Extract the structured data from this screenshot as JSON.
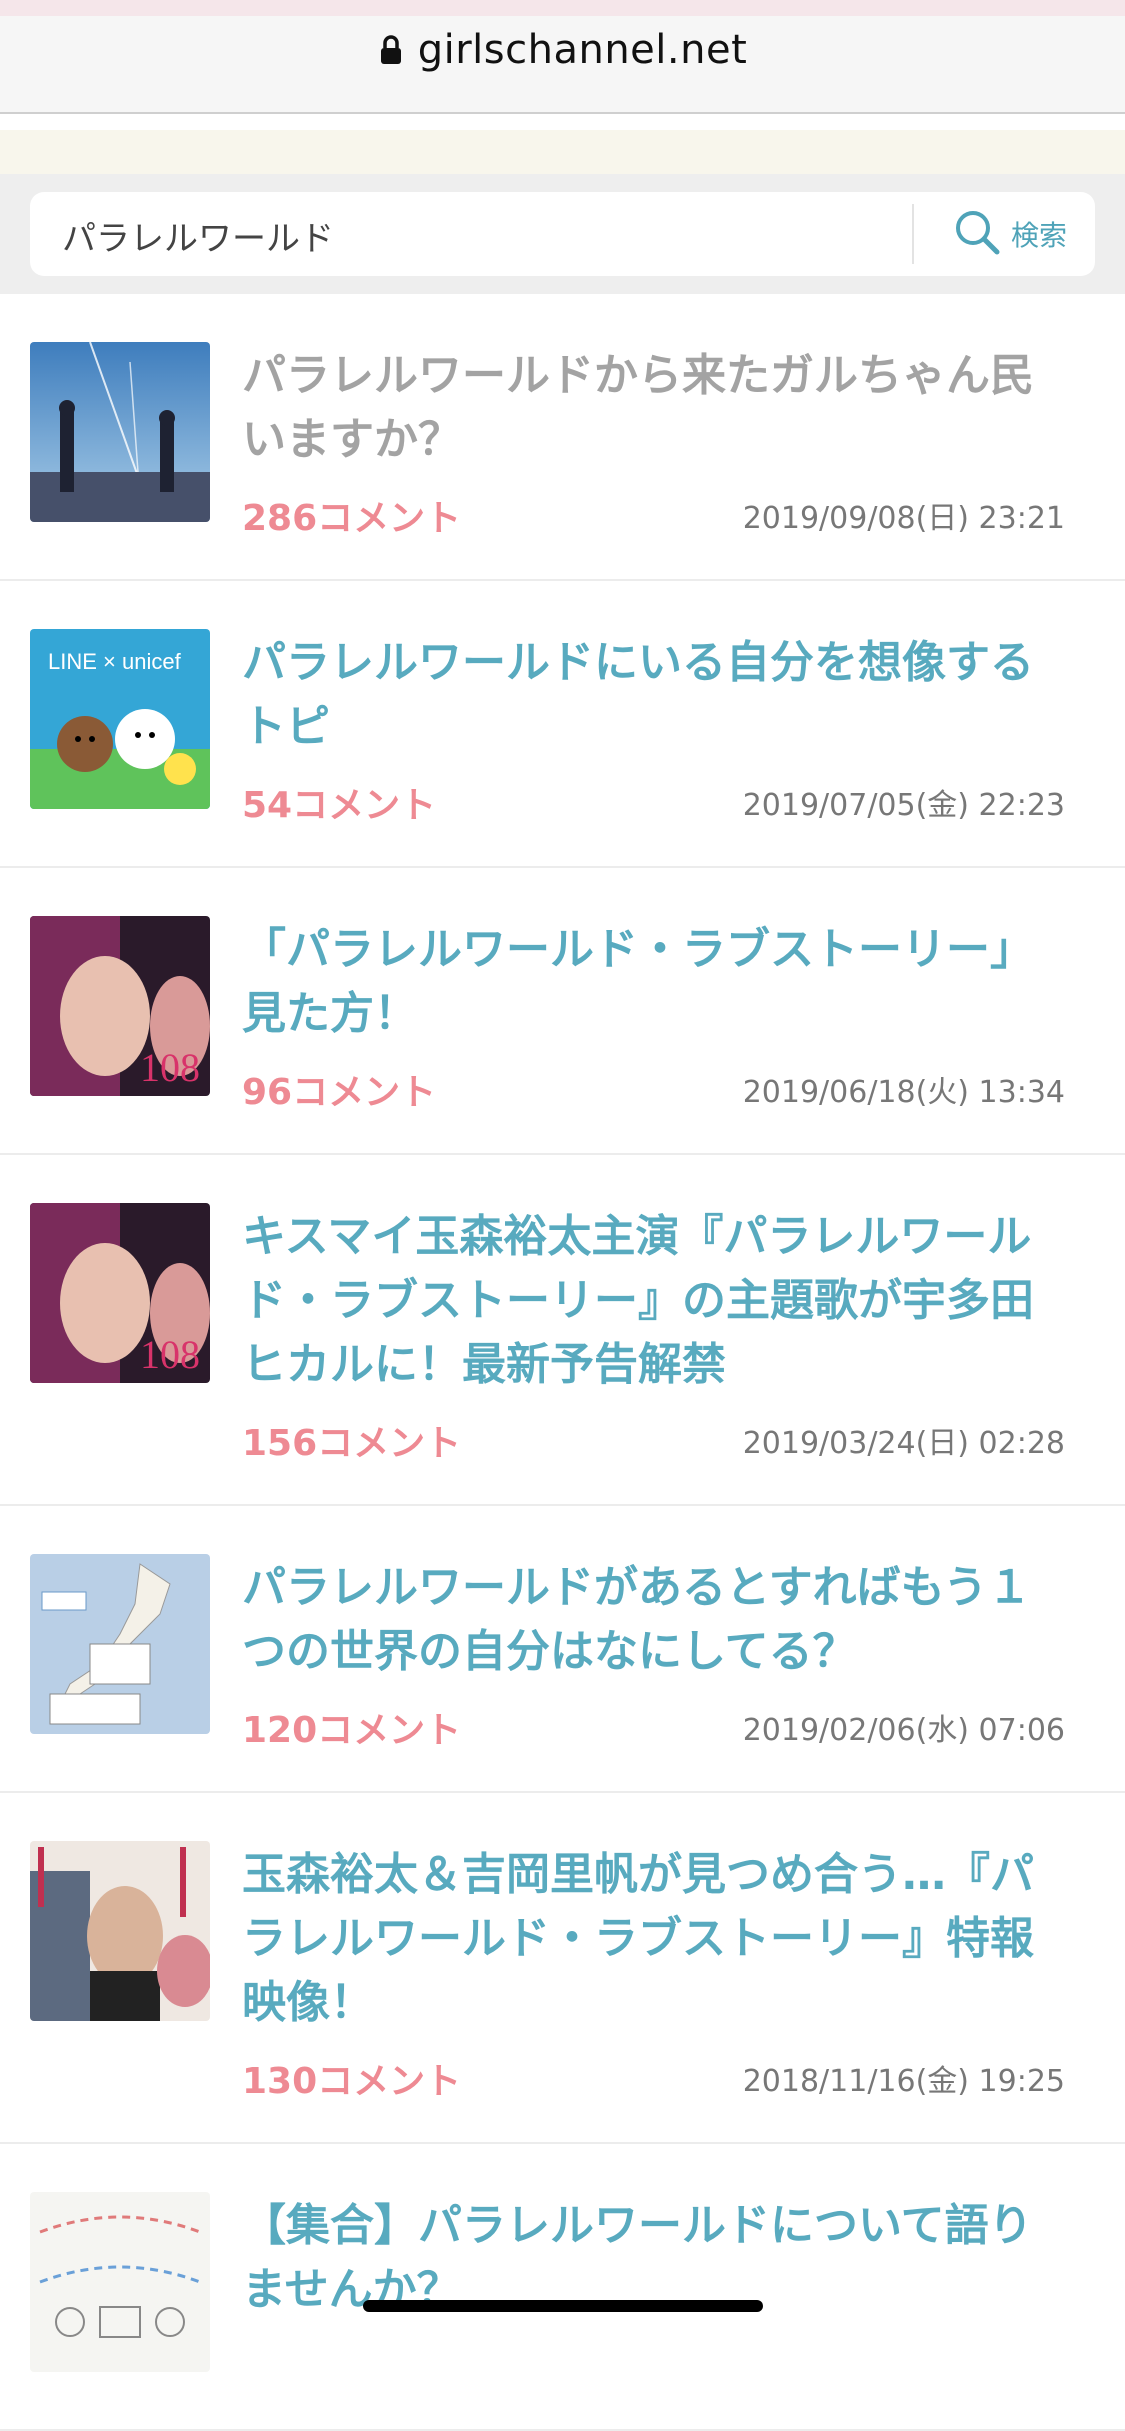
{
  "browser": {
    "url": "girlschannel.net"
  },
  "search": {
    "value": "パラレルワールド",
    "button_label": "検索"
  },
  "topics": [
    {
      "title": "パラレルワールドから来たガルちゃん民いますか？",
      "comments": "286コメント",
      "date": "2019/09/08(日) 23:21",
      "visited": true,
      "thumb": "anime-film-still"
    },
    {
      "title": "パラレルワールドにいる自分を想像するトピ",
      "comments": "54コメント",
      "date": "2019/07/05(金) 22:23",
      "visited": false,
      "thumb": "line-unicef-characters",
      "thumb_text": "LINE × unicef"
    },
    {
      "title": "「パラレルワールド・ラブストーリー」見た方！",
      "comments": "96コメント",
      "date": "2019/06/18(火) 13:34",
      "visited": false,
      "thumb": "movie-poster",
      "thumb_text": "108"
    },
    {
      "title": "キスマイ玉森裕太主演『パラレルワールド・ラブストーリー』の主題歌が宇多田ヒカルに！最新予告解禁",
      "comments": "156コメント",
      "date": "2019/03/24(日) 02:28",
      "visited": false,
      "thumb": "movie-poster",
      "thumb_text": "108"
    },
    {
      "title": "パラレルワールドがあるとすればもう１つの世界の自分はなにしてる？",
      "comments": "120コメント",
      "date": "2019/02/06(水) 07:06",
      "visited": false,
      "thumb": "japan-map"
    },
    {
      "title": "玉森裕太＆吉岡里帆が見つめ合う…『パラレルワールド・ラブストーリー』特報映像！",
      "comments": "130コメント",
      "date": "2018/11/16(金) 19:25",
      "visited": false,
      "thumb": "movie-poster-faces"
    },
    {
      "title": "【集合】パラレルワールドについて語りませんか？",
      "comments": "",
      "date": "",
      "visited": false,
      "thumb": "diagram-sketch"
    }
  ],
  "colors": {
    "title": "#58aabf",
    "title_visited": "#a3a3a3",
    "comments": "#ee8a93",
    "date": "#777777"
  },
  "icons": {
    "lock": "lock-icon",
    "search": "search-icon"
  }
}
